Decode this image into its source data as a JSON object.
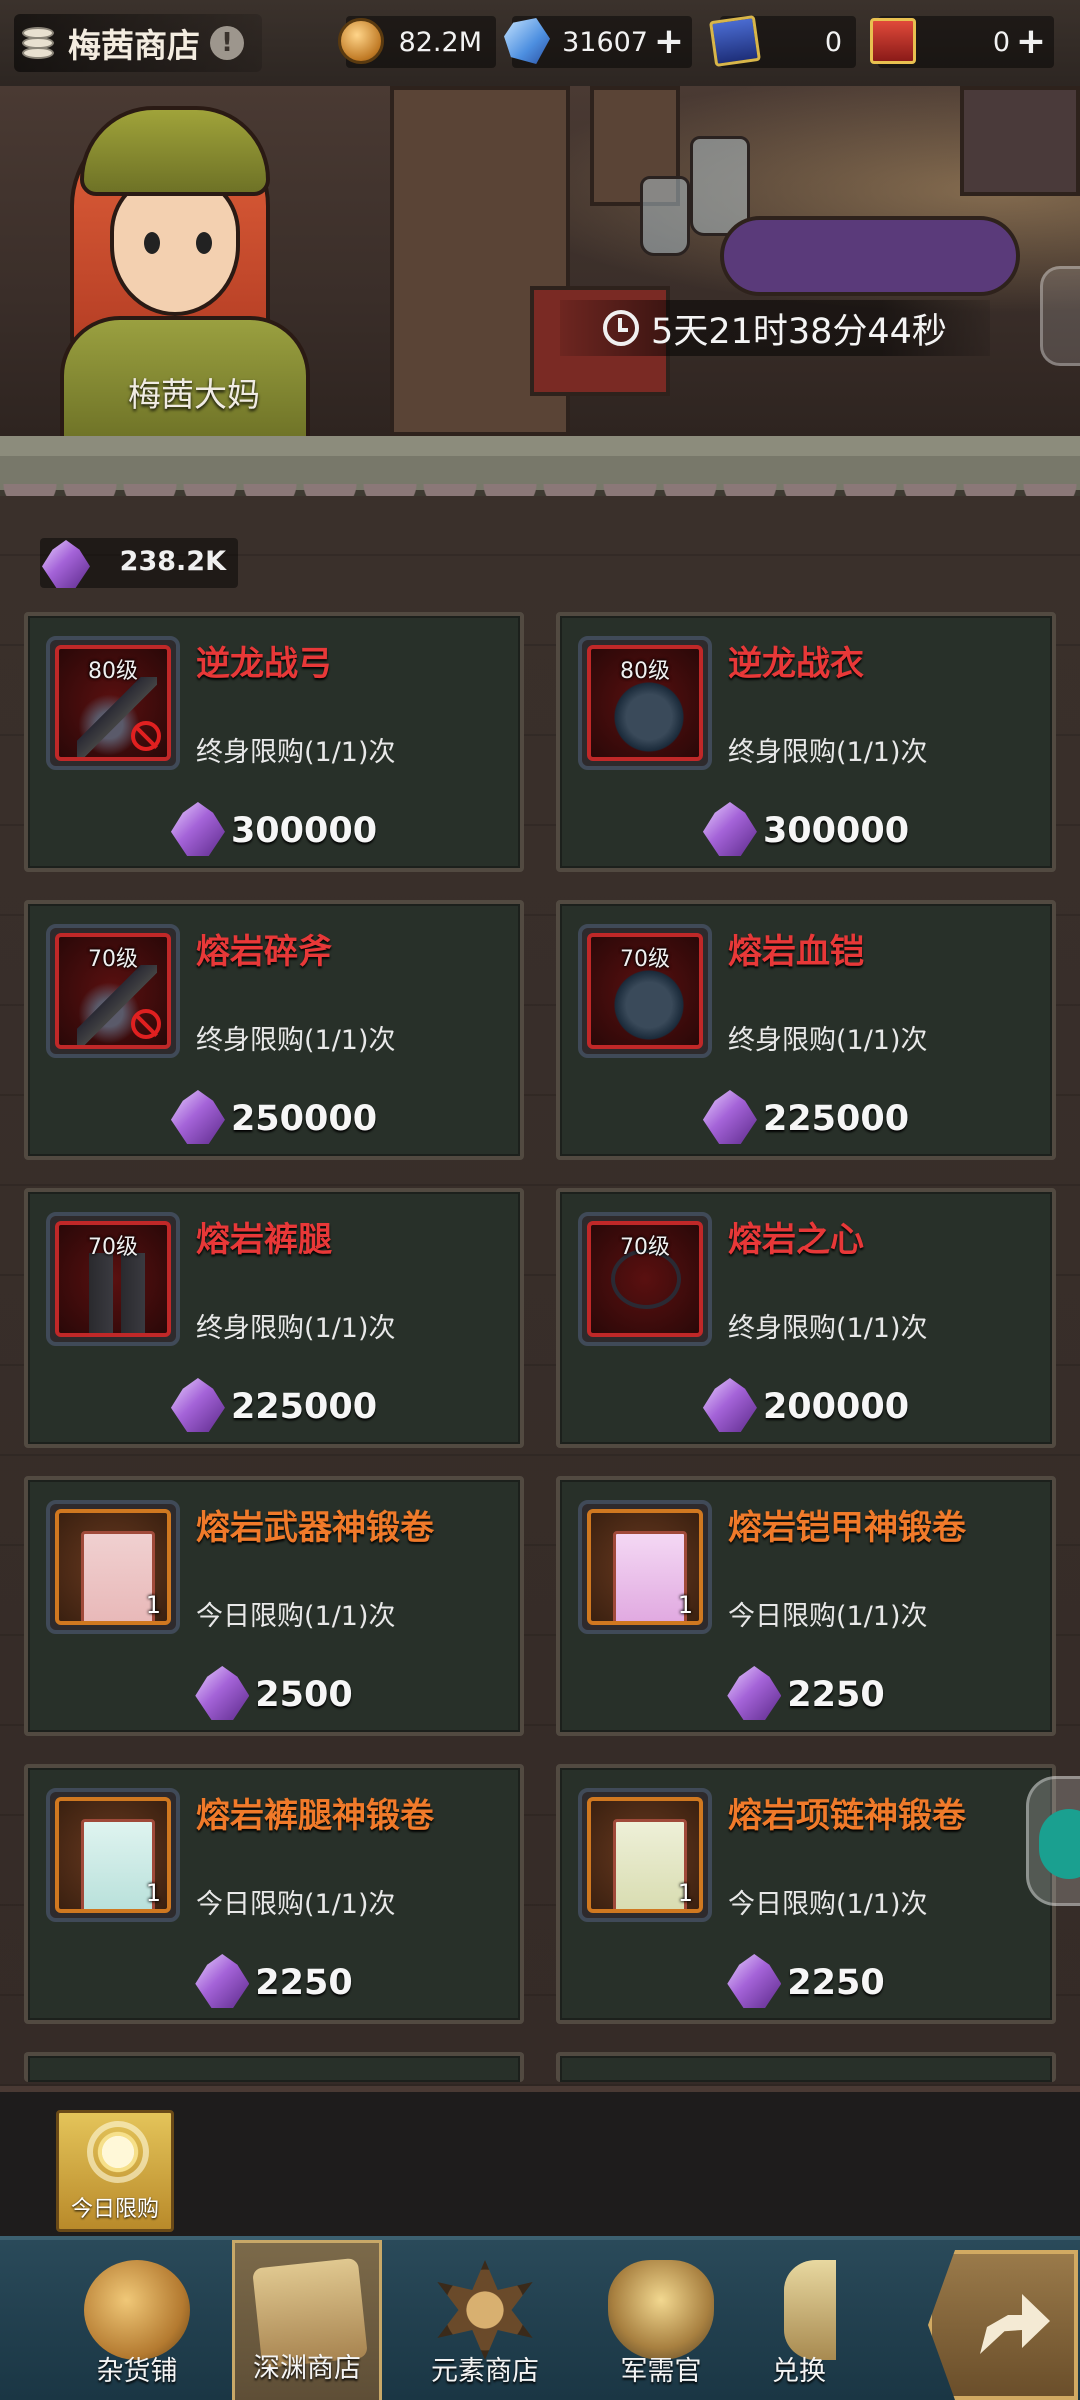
{
  "shop": {
    "title": "梅茜商店",
    "info_symbol": "!"
  },
  "resources": [
    {
      "icon": "gold-coin-icon",
      "value": "82.2M",
      "has_plus": false
    },
    {
      "icon": "blue-crystal-icon",
      "value": "31607",
      "has_plus": true
    },
    {
      "icon": "ticket-card-icon",
      "value": "0",
      "has_plus": false
    },
    {
      "icon": "gold-card-icon",
      "value": "0",
      "has_plus": true
    }
  ],
  "banner": {
    "npc_name": "梅茜大妈",
    "timer": "5天21时38分44秒"
  },
  "currency": {
    "icon": "purple-gem-icon",
    "value": "238.2K"
  },
  "items": [
    {
      "name": "逆龙战弓",
      "level": "80级",
      "limit": "终身限购(1/1)次",
      "price": "300000",
      "title_color": "red",
      "frame": "red",
      "art": "weapon",
      "banned": true,
      "qty": ""
    },
    {
      "name": "逆龙战衣",
      "level": "80级",
      "limit": "终身限购(1/1)次",
      "price": "300000",
      "title_color": "red",
      "frame": "red",
      "art": "armor",
      "banned": false,
      "qty": ""
    },
    {
      "name": "熔岩碎斧",
      "level": "70级",
      "limit": "终身限购(1/1)次",
      "price": "250000",
      "title_color": "red",
      "frame": "red",
      "art": "weapon",
      "banned": true,
      "qty": ""
    },
    {
      "name": "熔岩血铠",
      "level": "70级",
      "limit": "终身限购(1/1)次",
      "price": "225000",
      "title_color": "red",
      "frame": "red",
      "art": "armor",
      "banned": false,
      "qty": ""
    },
    {
      "name": "熔岩裤腿",
      "level": "70级",
      "limit": "终身限购(1/1)次",
      "price": "225000",
      "title_color": "red",
      "frame": "red",
      "art": "legs",
      "banned": false,
      "qty": ""
    },
    {
      "name": "熔岩之心",
      "level": "70级",
      "limit": "终身限购(1/1)次",
      "price": "200000",
      "title_color": "red",
      "frame": "red",
      "art": "necklace",
      "banned": false,
      "qty": ""
    },
    {
      "name": "熔岩武器神锻卷",
      "level": "",
      "limit": "今日限购(1/1)次",
      "price": "2500",
      "title_color": "orange",
      "frame": "orange",
      "art": "scroll",
      "banned": false,
      "qty": "1"
    },
    {
      "name": "熔岩铠甲神锻卷",
      "level": "",
      "limit": "今日限购(1/1)次",
      "price": "2250",
      "title_color": "orange",
      "frame": "orange",
      "art": "scroll pink",
      "banned": false,
      "qty": "1"
    },
    {
      "name": "熔岩裤腿神锻卷",
      "level": "",
      "limit": "今日限购(1/1)次",
      "price": "2250",
      "title_color": "orange",
      "frame": "orange",
      "art": "scroll cyan",
      "banned": false,
      "qty": "1"
    },
    {
      "name": "熔岩项链神锻卷",
      "level": "",
      "limit": "今日限购(1/1)次",
      "price": "2250",
      "title_color": "orange",
      "frame": "orange",
      "art": "scroll cream",
      "banned": false,
      "qty": "1"
    }
  ],
  "daily": {
    "label": "今日限购"
  },
  "nav": [
    {
      "label": "杂货铺",
      "icon": "coins",
      "active": false
    },
    {
      "label": "深渊商店",
      "icon": "abyss",
      "active": true
    },
    {
      "label": "元素商店",
      "icon": "element",
      "active": false
    },
    {
      "label": "军需官",
      "icon": "quarter",
      "active": false
    },
    {
      "label": "兑换",
      "icon": "exchange",
      "active": false
    }
  ],
  "colors": {
    "title_red": "#e83838",
    "title_orange": "#f07a2a",
    "card_bg": "#283029",
    "accent_gold": "#c8a868"
  }
}
